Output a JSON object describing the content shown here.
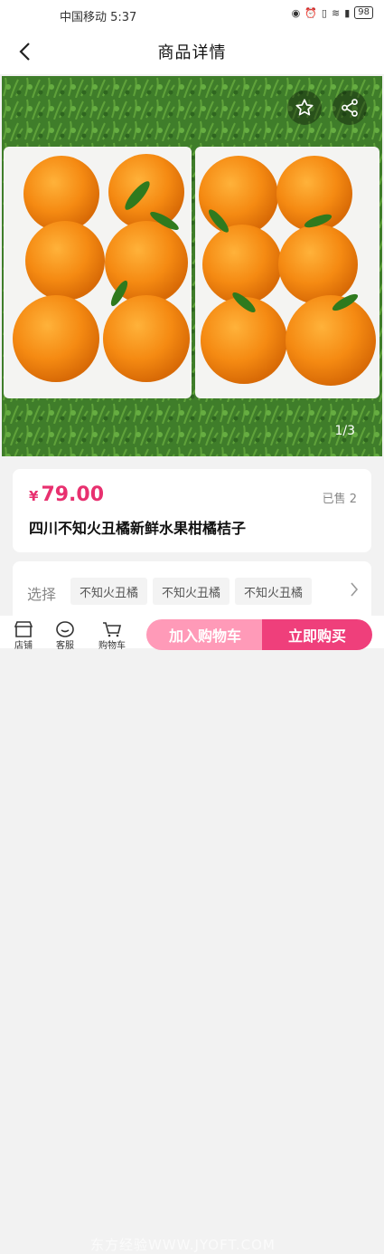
{
  "status": {
    "carrier_time": "中国移动 5:37",
    "battery": "98"
  },
  "nav": {
    "title": "商品详情"
  },
  "gallery": {
    "indicator": "1/3"
  },
  "product": {
    "currency": "¥",
    "price": "79.00",
    "sold": "已售 2",
    "name": "四川不知火丑橘新鲜水果柑橘桔子"
  },
  "options": {
    "label": "选择",
    "chips": [
      "不知火丑橘",
      "不知火丑橘",
      "不知火丑橘"
    ]
  },
  "bottom": {
    "icons": [
      "店铺",
      "客服",
      "购物车"
    ],
    "add_to_cart": "加入购物车",
    "buy_now": "立即购买",
    "watermark": "东方经验WWW.JYOFT.COM"
  },
  "colors": {
    "accent": "#ef3f7b",
    "accent_light": "#ff9ab8",
    "price": "#e8306f"
  }
}
